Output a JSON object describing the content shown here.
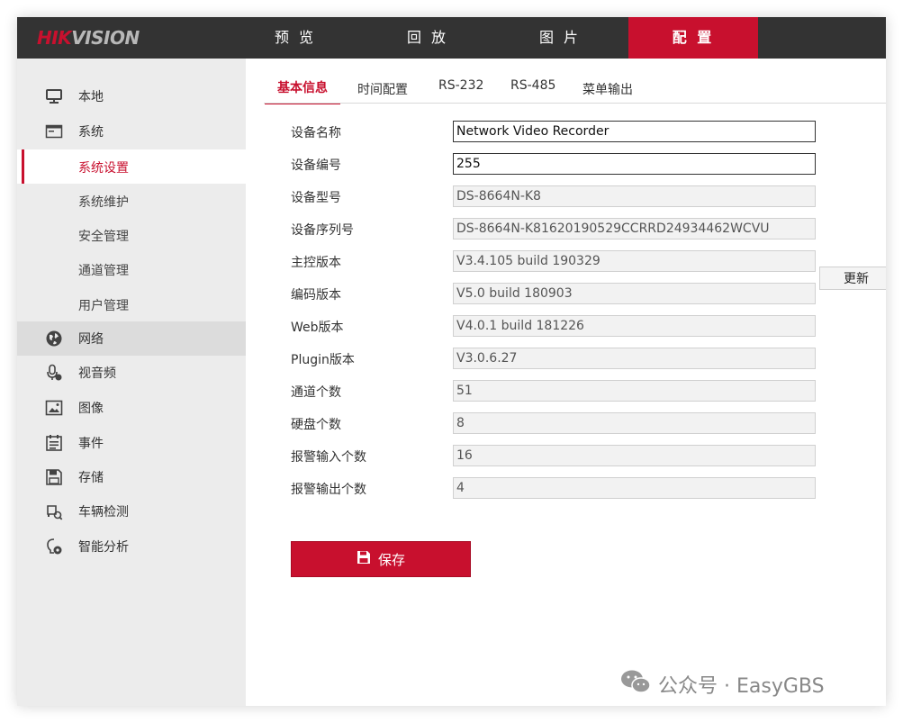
{
  "brand": {
    "logo_hik": "HIK",
    "logo_vision": "VISION"
  },
  "topnav": {
    "tabs": [
      {
        "label": "预 览"
      },
      {
        "label": "回 放"
      },
      {
        "label": "图 片"
      },
      {
        "label": "配 置",
        "active": true
      }
    ]
  },
  "sidebar": {
    "local": "本地",
    "system": "系统",
    "system_sub": [
      "系统设置",
      "系统维护",
      "安全管理",
      "通道管理",
      "用户管理"
    ],
    "network": "网络",
    "audio_video": "视音频",
    "image": "图像",
    "event": "事件",
    "storage": "存储",
    "vehicle": "车辆检测",
    "smart": "智能分析"
  },
  "subtabs": [
    "基本信息",
    "时间配置",
    "RS-232",
    "RS-485",
    "菜单输出"
  ],
  "form": {
    "device_name_label": "设备名称",
    "device_name": "Network Video Recorder",
    "device_no_label": "设备编号",
    "device_no": "255",
    "model_label": "设备型号",
    "model": "DS-8664N-K8",
    "serial_label": "设备序列号",
    "serial": "DS-8664N-K81620190529CCRRD24934462WCVU",
    "firmware_label": "主控版本",
    "firmware": "V3.4.105 build 190329",
    "encode_label": "编码版本",
    "encode": "V5.0 build 180903",
    "web_label": "Web版本",
    "web": "V4.0.1 build 181226",
    "plugin_label": "Plugin版本",
    "plugin": "V3.0.6.27",
    "channels_label": "通道个数",
    "channels": "51",
    "disks_label": "硬盘个数",
    "disks": "8",
    "alarm_in_label": "报警输入个数",
    "alarm_in": "16",
    "alarm_out_label": "报警输出个数",
    "alarm_out": "4"
  },
  "buttons": {
    "update": "更新",
    "save": "保存"
  },
  "watermark": {
    "text": "公众号 · EasyGBS"
  },
  "colors": {
    "accent": "#c8102e",
    "topbar": "#333333",
    "sidebar": "#ececec"
  }
}
